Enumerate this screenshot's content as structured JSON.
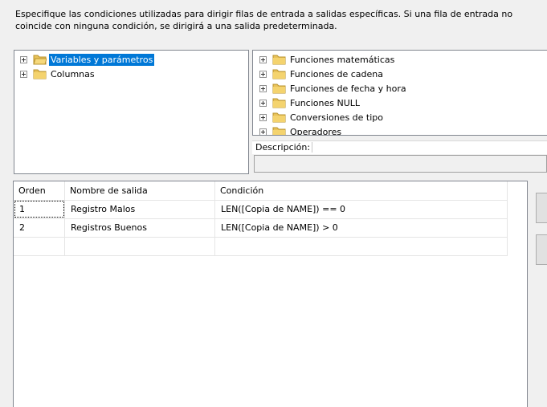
{
  "description": "Especifique las condiciones utilizadas para dirigir filas de entrada a salidas específicas. Si una fila de entrada no coincide con ninguna condición, se dirigirá a una salida predeterminada.",
  "left_tree": {
    "items": [
      {
        "label": "Variables y parámetros",
        "selected": true,
        "icon": "open-folder-icon"
      },
      {
        "label": "Columnas",
        "selected": false,
        "icon": "folder-icon"
      }
    ]
  },
  "right_tree": {
    "items": [
      {
        "label": "Funciones matemáticas",
        "icon": "folder-icon"
      },
      {
        "label": "Funciones de cadena",
        "icon": "folder-icon"
      },
      {
        "label": "Funciones de fecha y hora",
        "icon": "folder-icon"
      },
      {
        "label": "Funciones NULL",
        "icon": "folder-icon"
      },
      {
        "label": "Conversiones de tipo",
        "icon": "folder-icon"
      },
      {
        "label": "Operadores",
        "icon": "folder-icon"
      }
    ]
  },
  "description_panel": {
    "label": "Descripción:",
    "value": ""
  },
  "grid": {
    "headers": {
      "order": "Orden",
      "output_name": "Nombre de salida",
      "condition": "Condición"
    },
    "rows": [
      {
        "order": "1",
        "output_name": "Registro Malos",
        "condition": "LEN([Copia de NAME]) == 0"
      },
      {
        "order": "2",
        "output_name": "Registros Buenos",
        "condition": "LEN([Copia de NAME]) > 0"
      },
      {
        "order": "",
        "output_name": "",
        "condition": ""
      }
    ]
  },
  "colors": {
    "selection": "#0078d7",
    "folder": "#e8c25a",
    "border": "#828790"
  }
}
